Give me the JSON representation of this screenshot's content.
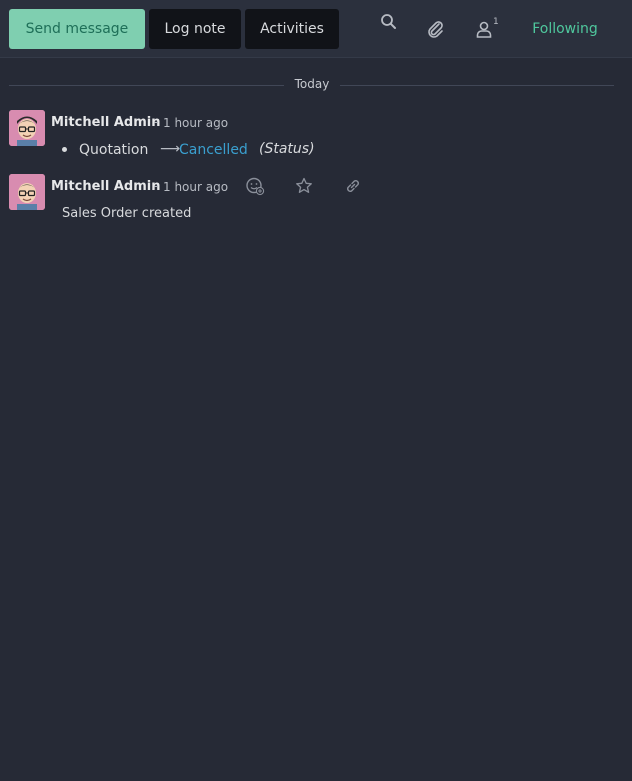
{
  "toolbar": {
    "send_message": "Send message",
    "log_note": "Log note",
    "activities": "Activities",
    "follower_count": "1",
    "following": "Following"
  },
  "divider": {
    "label": "Today"
  },
  "messages": [
    {
      "author": "Mitchell Admin",
      "separator": "-",
      "time": "1 hour ago",
      "tracking": {
        "field": "Quotation",
        "new_value": "Cancelled",
        "field_name": "(Status)"
      }
    },
    {
      "author": "Mitchell Admin",
      "separator": "-",
      "time": "1 hour ago",
      "body": "Sales Order created"
    }
  ],
  "icons": {
    "search": "search-icon",
    "attachment": "paperclip-icon",
    "followers": "user-icon",
    "reaction": "add-reaction-icon",
    "star": "star-icon",
    "link": "link-icon"
  },
  "colors": {
    "accent": "#7fcfb0",
    "following": "#4fc79d",
    "link_value": "#3a9fcf",
    "background": "#262a36"
  }
}
